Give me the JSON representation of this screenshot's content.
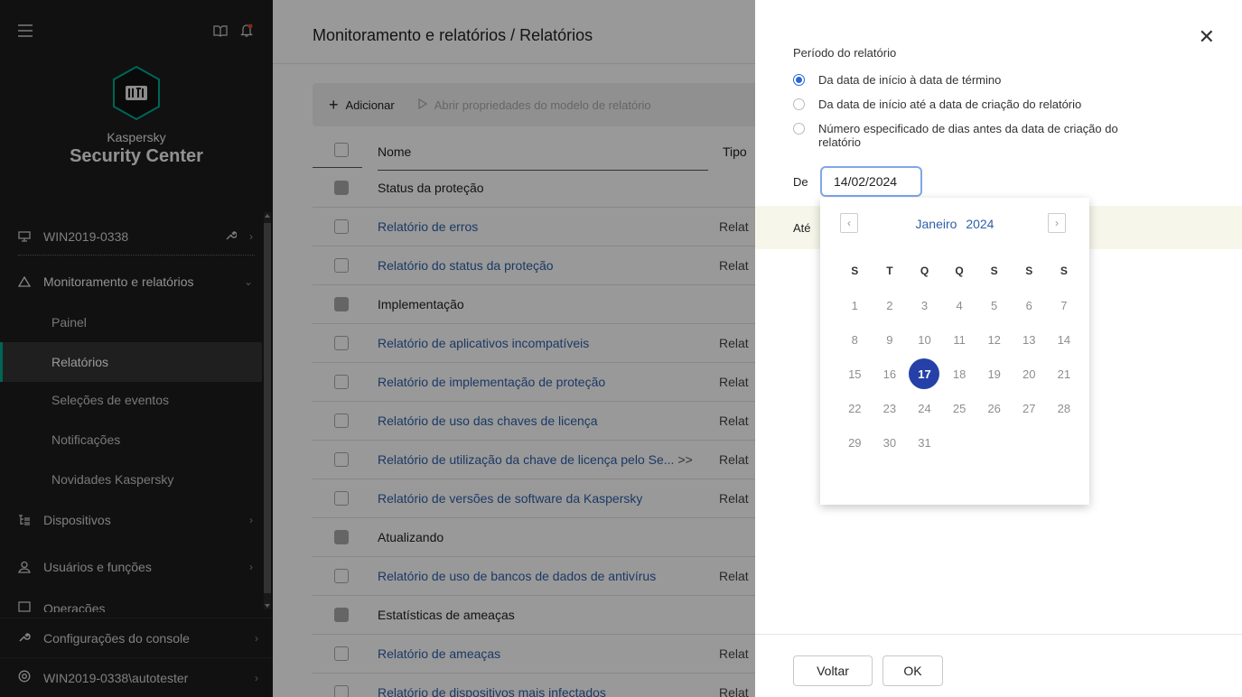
{
  "sidebar": {
    "brand_line1": "Kaspersky",
    "brand_line2": "Security Center",
    "logo_text": "ꟷ",
    "server": "WIN2019-0338",
    "section": "Monitoramento e relatórios",
    "sub_items": [
      "Painel",
      "Relatórios",
      "Seleções de eventos",
      "Notificações",
      "Novidades Kaspersky"
    ],
    "devices": "Dispositivos",
    "users": "Usuários e funções",
    "operations": "Operações",
    "console_settings": "Configurações do console",
    "user_account": "WIN2019-0338\\autotester"
  },
  "main": {
    "breadcrumb": "Monitoramento e relatórios  /  Relatórios",
    "toolbar": {
      "add_label": "Adicionar",
      "open_props_label": "Abrir propriedades do modelo de relatório"
    },
    "columns": {
      "name": "Nome",
      "type": "Tipo"
    },
    "rows": [
      {
        "name": "Status da proteção",
        "type": ""
      },
      {
        "name": "Relatório de erros",
        "type": "Relat"
      },
      {
        "name": "Relatório do status da proteção",
        "type": "Relat"
      },
      {
        "name": "Implementação",
        "type": ""
      },
      {
        "name": "Relatório de aplicativos incompatíveis",
        "type": "Relat"
      },
      {
        "name": "Relatório de implementação de proteção",
        "type": "Relat"
      },
      {
        "name": "Relatório de uso das chaves de licença",
        "type": "Relat"
      },
      {
        "name": "Relatório de utilização da chave de licença pelo Se...",
        "more": ">>",
        "type": "Relat"
      },
      {
        "name": "Relatório de versões de software da Kaspersky",
        "type": "Relat"
      },
      {
        "name": "Atualizando",
        "type": ""
      },
      {
        "name": "Relatório de uso de bancos de dados de antivírus",
        "type": "Relat"
      },
      {
        "name": "Estatísticas de ameaças",
        "type": ""
      },
      {
        "name": "Relatório de ameaças",
        "type": "Relat"
      },
      {
        "name": "Relatório de dispositivos mais infectados",
        "type": "Relat"
      }
    ]
  },
  "panel": {
    "title": "Período do relatório",
    "options": [
      "Da data de início à data de término",
      "Da data de início até a data de criação do relatório",
      "Número especificado de dias antes da data de criação do",
      "relatório"
    ],
    "selected_option": 0,
    "from_label": "De",
    "from_value": "14/02/2024",
    "to_label": "Até",
    "back_button": "Voltar",
    "ok_button": "OK",
    "close_icon": "close-icon"
  },
  "calendar": {
    "month": "Janeiro",
    "year": "2024",
    "weekdays": [
      "S",
      "T",
      "Q",
      "Q",
      "S",
      "S",
      "S"
    ],
    "days": [
      "1",
      "2",
      "3",
      "4",
      "5",
      "6",
      "7",
      "8",
      "9",
      "10",
      "11",
      "12",
      "13",
      "14",
      "15",
      "16",
      "17",
      "18",
      "19",
      "20",
      "21",
      "22",
      "23",
      "24",
      "25",
      "26",
      "27",
      "28",
      "29",
      "30",
      "31"
    ],
    "selected_day": "17",
    "accent": "#2541a8"
  }
}
